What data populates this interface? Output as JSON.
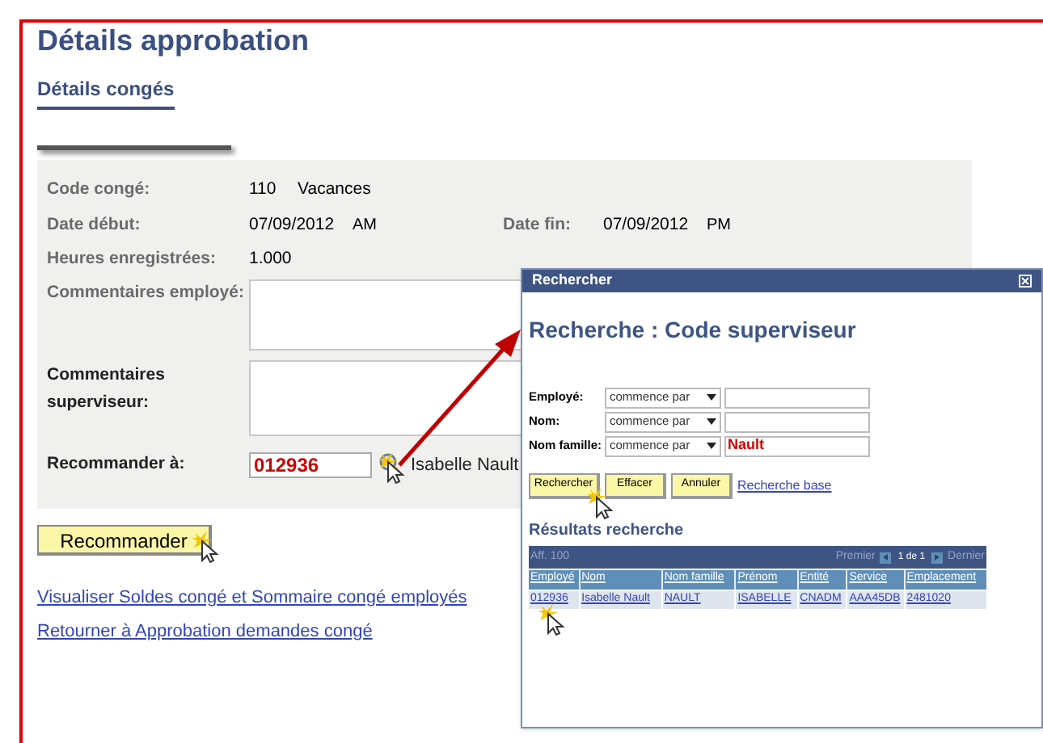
{
  "page": {
    "title": "Détails approbation",
    "section_tab": "Détails congés"
  },
  "leave_details": {
    "code": {
      "label": "Code congé:",
      "code": "110",
      "description": "Vacances"
    },
    "start": {
      "label": "Date début:",
      "date": "07/09/2012",
      "period": "AM"
    },
    "end": {
      "label": "Date fin:",
      "date": "07/09/2012",
      "period": "PM"
    },
    "hours": {
      "label": "Heures enregistrées:",
      "value": "1.000"
    },
    "employee_comments": {
      "label": "Commentaires employé:"
    },
    "supervisor_comments": {
      "label": "Commentaires superviseur:"
    },
    "recommend_to": {
      "label": "Recommander à:",
      "value": "012936",
      "name": "Isabelle Nault"
    }
  },
  "recommend_button": "Recommander",
  "links": [
    "Visualiser Soldes congé et Sommaire congé employés",
    "Retourner à Approbation demandes congé"
  ],
  "lookup_dialog": {
    "title": "Rechercher",
    "heading": "Recherche : Code superviseur",
    "criteria": [
      {
        "label": "Employé:",
        "operator": "commence par"
      },
      {
        "label": "Nom:",
        "operator": "commence par"
      },
      {
        "label": "Nom famille:",
        "operator": "commence par",
        "value": "Nault"
      }
    ],
    "buttons": [
      "Rechercher",
      "Effacer",
      "Annuler"
    ],
    "basic_search_link": "Recherche base",
    "results": {
      "heading": "Résultats recherche",
      "toolbar": {
        "count": "Aff. 100",
        "first": "Premier",
        "page": "1 de 1",
        "last": "Dernier"
      },
      "columns": [
        "Employé",
        "Nom",
        "Nom famille",
        "Prénom",
        "Entité",
        "Service",
        "Emplacement"
      ],
      "rows": [
        [
          "012936",
          "Isabelle Nault",
          "NAULT",
          "ISABELLE",
          "CNADM",
          "AAA45DB",
          "2481020"
        ]
      ]
    }
  }
}
